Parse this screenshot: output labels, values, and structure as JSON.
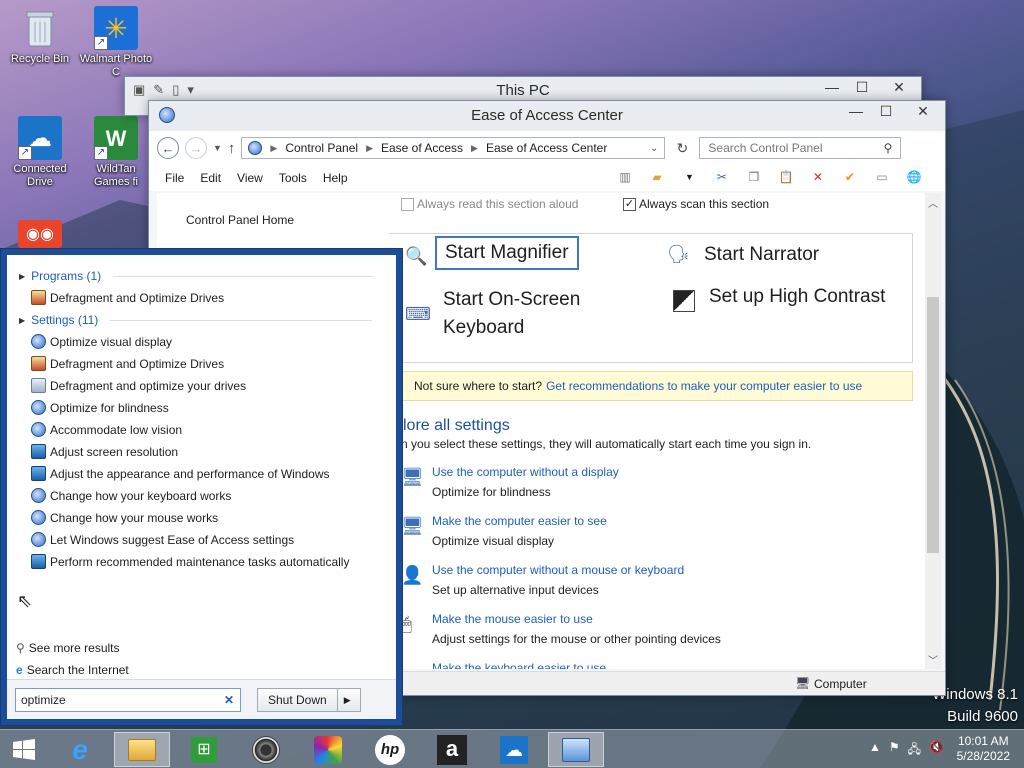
{
  "desktop": {
    "icons": [
      {
        "label": "Recycle Bin"
      },
      {
        "label": "Walmart Photo C"
      },
      {
        "label": "Connected Drive"
      },
      {
        "label": "WildTan Games fi"
      }
    ],
    "watermark": {
      "line1": "Windows 8.1",
      "line2": "Build 9600"
    }
  },
  "this_pc": {
    "title": "This PC"
  },
  "eoac": {
    "title": "Ease of Access Center",
    "breadcrumb": [
      "Control Panel",
      "Ease of Access",
      "Ease of Access Center"
    ],
    "search_placeholder": "Search Control Panel",
    "menu": [
      "File",
      "Edit",
      "View",
      "Tools",
      "Help"
    ],
    "left_nav": {
      "home": "Control Panel Home"
    },
    "checkbox_read": "Always read this section aloud",
    "checkbox_scan": "Always scan this section",
    "quick": {
      "magnifier": "Start Magnifier",
      "narrator": "Start Narrator",
      "osk": "Start On-Screen Keyboard",
      "contrast": "Set up High Contrast"
    },
    "notice": {
      "text": "Not sure where to start?",
      "link": "Get recommendations to make your computer easier to use"
    },
    "explore_title": "lore all settings",
    "explore_sub": "n you select these settings, they will automatically start each time you sign in.",
    "settings": [
      {
        "link": "Use the computer without a display",
        "desc": "Optimize for blindness"
      },
      {
        "link": "Make the computer easier to see",
        "desc": "Optimize visual display"
      },
      {
        "link": "Use the computer without a mouse or keyboard",
        "desc": "Set up alternative input devices"
      },
      {
        "link": "Make the mouse easier to use",
        "desc": "Adjust settings for the mouse or other pointing devices"
      },
      {
        "link": "Make the keyboard easier to use",
        "desc": ""
      }
    ],
    "status": "Computer"
  },
  "start": {
    "programs_header": "Programs (1)",
    "programs": [
      "Defragment and Optimize Drives"
    ],
    "settings_header": "Settings (11)",
    "settings": [
      "Optimize visual display",
      "Defragment and Optimize Drives",
      "Defragment and optimize your drives",
      "Optimize for blindness",
      "Accommodate low vision",
      "Adjust screen resolution",
      "Adjust the appearance and performance of Windows",
      "Change how your keyboard works",
      "Change how your mouse works",
      "Let Windows suggest Ease of Access settings",
      "Perform recommended maintenance tasks automatically"
    ],
    "see_more": "See more results",
    "search_internet": "Search the Internet",
    "query": "optimize",
    "shutdown": "Shut Down"
  },
  "taskbar": {
    "time": "10:01 AM",
    "date": "5/28/2022"
  }
}
